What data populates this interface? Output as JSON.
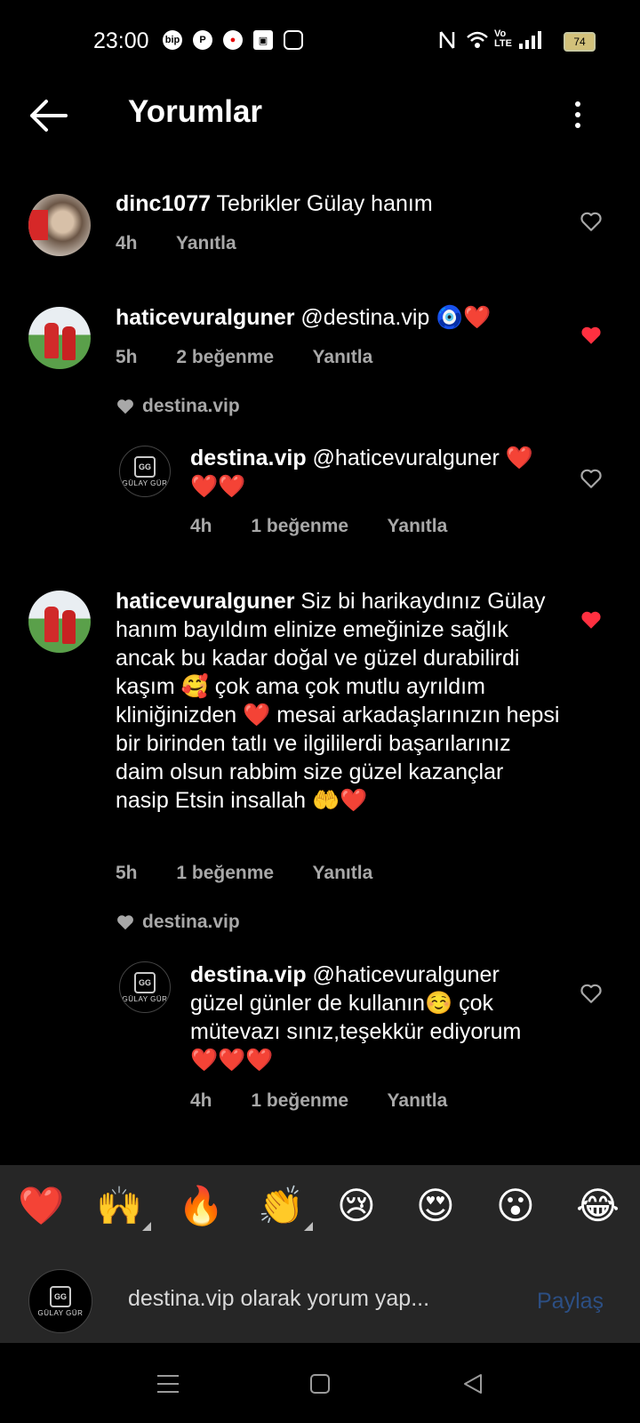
{
  "status_bar": {
    "time": "23:00",
    "app_icons": [
      "bip-icon",
      "pinterest-icon",
      "vodafone-icon",
      "box-icon",
      "instagram-icon"
    ],
    "volte": "Vo LTE",
    "battery": "74"
  },
  "header": {
    "title": "Yorumlar"
  },
  "comments": [
    {
      "username": "dinc1077",
      "text": "Tebrikler Gülay hanım",
      "time": "4h",
      "likes": "",
      "reply_label": "Yanıtla",
      "liked": false
    },
    {
      "username": "haticevuralguner",
      "text": "@destina.vip 🧿❤️",
      "time": "5h",
      "likes": "2 beğenme",
      "reply_label": "Yanıtla",
      "liked": true,
      "liked_by": "destina.vip",
      "reply": {
        "username": "destina.vip",
        "text": "@haticevuralguner ❤️❤️❤️",
        "time": "4h",
        "likes": "1 beğenme",
        "reply_label": "Yanıtla",
        "liked": false
      }
    },
    {
      "username": "haticevuralguner",
      "text": "Siz bi harikaydınız Gülay hanım bayıldım elinize emeğinize sağlık ancak bu kadar doğal ve güzel durabilirdi kaşım 🥰 çok ama çok mutlu ayrıldım kliniğinizden ❤️ mesai arkadaşlarınızın hepsi bir birinden tatlı ve ilgililerdi başarılarınız daim olsun rabbim size güzel kazançlar nasip Etsin insallah 🤲❤️",
      "time": "5h",
      "likes": "1 beğenme",
      "reply_label": "Yanıtla",
      "liked": true,
      "liked_by": "destina.vip",
      "reply": {
        "username": "destina.vip",
        "text": "@haticevuralguner güzel günler de kullanın☺️ çok mütevazı sınız,teşekkür ediyorum ❤️❤️❤️",
        "time": "4h",
        "likes": "1 beğenme",
        "reply_label": "Yanıtla",
        "liked": false
      }
    }
  ],
  "logo_text": {
    "mono": "GG",
    "word": "GÜLAY GÜR"
  },
  "emoji_bar": [
    "❤️",
    "🙌",
    "🔥",
    "👏",
    "😢",
    "😍",
    "😮",
    "😂"
  ],
  "input": {
    "placeholder": "destina.vip olarak yorum yap...",
    "share_label": "Paylaş"
  },
  "colors": {
    "background": "#000000",
    "liked_heart": "#ff3040",
    "secondary_text": "#a8a8a8",
    "panel": "#262626",
    "share_disabled": "#2c4f84"
  }
}
